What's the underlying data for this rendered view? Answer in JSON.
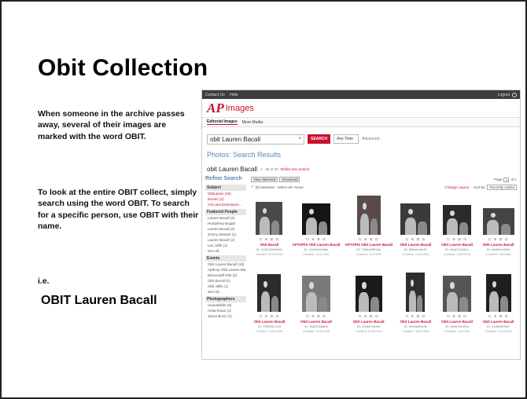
{
  "slide": {
    "title": "Obit Collection",
    "para1": "When someone in the archive passes away, several of their images are marked with the word OBIT.",
    "para2": "To look at the entire OBIT collect, simply search using the word OBIT.  To search for a specific person, use OBIT with their name.",
    "para3": "i.e.",
    "example": "OBIT Lauren Bacall"
  },
  "screenshot": {
    "topbar": {
      "links": [
        "Contact Us",
        "Help"
      ],
      "logout": "Logout"
    },
    "brand": {
      "ap": "AP",
      "images": "Images"
    },
    "tabs": [
      "Editorial Images",
      "More Media"
    ],
    "search": {
      "value": "obit Lauren Bacall",
      "button": "SEARCH",
      "time": "Any Time",
      "advanced": "Advanced"
    },
    "results_heading": "Photos: Search Results",
    "query": {
      "text": "obit Lauren Bacall",
      "meta": "1 - 30 of 30",
      "refine": "Refine this Search"
    },
    "sidebar": {
      "title": "Refine Search",
      "subject_header": "Subject",
      "subject_items": [
        "Obituaries (16)",
        "Events (2)",
        "Arts and Entertainm..."
      ],
      "people_header": "Featured People",
      "people_items": [
        "Lauren Bacall (4)",
        "Humphrey Bogart",
        "Lauren Bacall (2)",
        "Jimmy Stewart (1)",
        "Lauren Bacall (2)",
        "Leo Jaffe (1)",
        "See all..."
      ],
      "events_header": "Events",
      "events_items": [
        "Obit Lauren Bacall (18)",
        "Apthorp Obit Lauren Bacall (2)",
        "Bickerstaff Obit (2)",
        "Obit Bacall (1)",
        "Obit Jaffe (1)",
        "See all..."
      ],
      "photographers_header": "Photographers",
      "photographers_items": [
        "Unavailable (8)",
        "Anita Kraus (1)",
        "Jason Bucci (1)"
      ]
    },
    "toolbar": {
      "btn1": "View Selected",
      "btn2": "Download",
      "page_label": "Page",
      "page_value": "1",
      "page_of": "of 1"
    },
    "selrow": {
      "selected": "[0] Selected",
      "select_all": "Select all",
      "none": "None",
      "change": "Change Layout",
      "sort_label": "Sort by:",
      "sort_value": "Recently Added"
    },
    "icons": "⊡ ⊕ ⊞ ⊟",
    "thumbs": [
      {
        "caption": "Obit Bacall",
        "id": "ID: 3761152bb346",
        "created": "Created: 8/12/2014",
        "bg": "#4a4a4a"
      },
      {
        "caption": "APTOPIX Obit Lauren Bacall",
        "id": "ID: 41e2b16488e",
        "created": "Created: 1/11/1961",
        "bg": "#151515"
      },
      {
        "caption": "APTOPIX Obit Lauren Bacall",
        "id": "ID: 7b36e3983ab",
        "created": "Created: 1/3/1945",
        "bg": "#5a4a4a"
      },
      {
        "caption": "Obit Lauren Bacall",
        "id": "ID: 68f0a1c8b97",
        "created": "Created: 2/10/1955",
        "bg": "#3a3a3a"
      },
      {
        "caption": "Obit Lauren Bacall",
        "id": "ID: 46d27b2b5c1",
        "created": "Created: 1/30/1978",
        "bg": "#2a2a2a"
      },
      {
        "caption": "Obit Lauren Bacall",
        "id": "ID: 4fd0b1c93e6",
        "created": "Created: 3/5/1981",
        "bg": "#444"
      },
      {
        "caption": "Obit Lauren Bacall",
        "id": "ID: 7082e9c7c3f",
        "created": "Created: 2/11/1999",
        "bg": "#2c2c2c"
      },
      {
        "caption": "Obit Lauren Bacall",
        "id": "ID: 3fd2216a8b6",
        "created": "Created: 2/20/1946",
        "bg": "#7a7a7a"
      },
      {
        "caption": "Obit Lauren Bacall",
        "id": "ID: 203b976ef46",
        "created": "Created: 8/28/1943",
        "bg": "#1a1a1a"
      },
      {
        "caption": "Obit Lauren Bacall",
        "id": "ID: 99e6a0f4b3c",
        "created": "Created: 3/20/1956",
        "bg": "#2e2e2e"
      },
      {
        "caption": "Obit Lauren Bacall",
        "id": "ID: 8b3d7e1f20a",
        "created": "Created: 1/6/1964",
        "bg": "#555"
      },
      {
        "caption": "Obit Lauren Bacall",
        "id": "ID: c1d8e6f03b7",
        "created": "Created: 2/12/1953",
        "bg": "#1f1f1f"
      }
    ]
  }
}
